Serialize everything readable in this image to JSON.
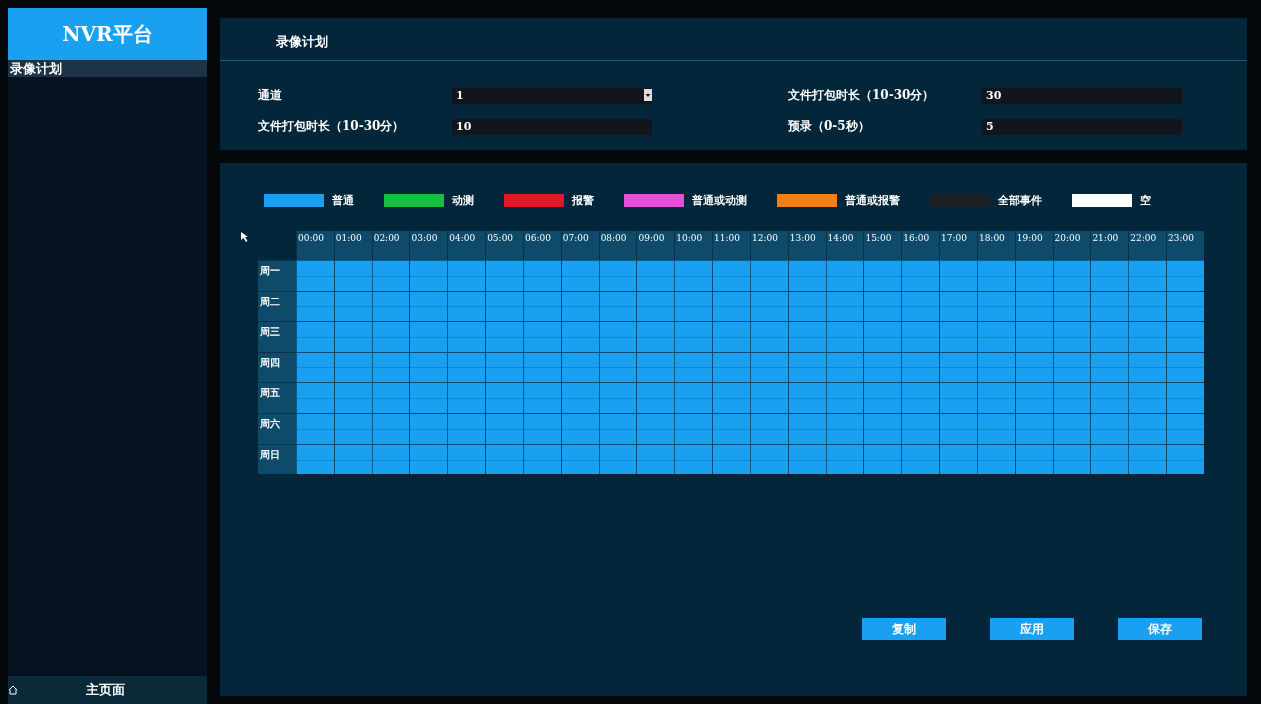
{
  "sidebar": {
    "title": "NVR平台",
    "items": [
      {
        "label": "录像计划",
        "selected": true
      }
    ],
    "home": {
      "label": "主页面"
    }
  },
  "settings": {
    "title": "录像计划",
    "fields": [
      {
        "label": "通道",
        "value": "1",
        "kind": "dropdown"
      },
      {
        "label": "文件打包时长（10-30分）",
        "value": "30",
        "kind": "text"
      },
      {
        "label": "文件打包时长（10-30分）",
        "value": "10",
        "kind": "text"
      },
      {
        "label": "预录（0-5秒）",
        "value": "5",
        "kind": "text"
      }
    ]
  },
  "legend": [
    {
      "label": "普通",
      "color": "#1aa0f0",
      "kind": "normal"
    },
    {
      "label": "动测",
      "color": "#14c040",
      "kind": "motion"
    },
    {
      "label": "报警",
      "color": "#e01828",
      "kind": "alarm"
    },
    {
      "label": "普通或动测",
      "color": "#e050d8",
      "kind": "normal_or_motion"
    },
    {
      "label": "普通或报警",
      "color": "#f08018",
      "kind": "normal_or_alarm"
    },
    {
      "label": "全部事件",
      "color": "#1c2024",
      "kind": "all"
    },
    {
      "label": "空",
      "color": "#ffffff",
      "kind": "empty"
    }
  ],
  "schedule": {
    "hours": [
      "00:00",
      "01:00",
      "02:00",
      "03:00",
      "04:00",
      "05:00",
      "06:00",
      "07:00",
      "08:00",
      "09:00",
      "10:00",
      "11:00",
      "12:00",
      "13:00",
      "14:00",
      "15:00",
      "16:00",
      "17:00",
      "18:00",
      "19:00",
      "20:00",
      "21:00",
      "22:00",
      "23:00"
    ],
    "days": [
      {
        "label": "周一",
        "kind": "normal"
      },
      {
        "label": "周二",
        "kind": "normal"
      },
      {
        "label": "周三",
        "kind": "normal"
      },
      {
        "label": "周四",
        "kind": "normal"
      },
      {
        "label": "周五",
        "kind": "normal"
      },
      {
        "label": "周六",
        "kind": "normal"
      },
      {
        "label": "周日",
        "kind": "normal"
      }
    ]
  },
  "buttons": [
    "复制",
    "应用",
    "保存"
  ]
}
